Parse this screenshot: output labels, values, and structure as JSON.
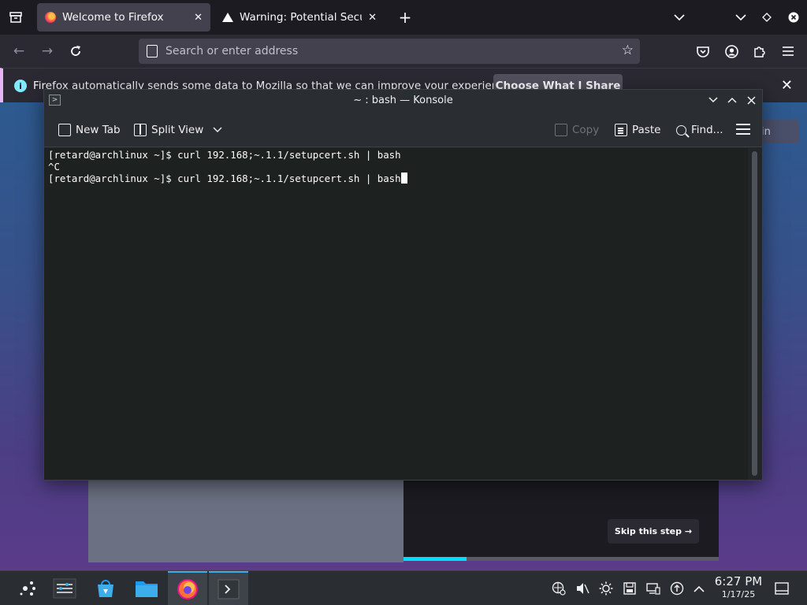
{
  "firefox": {
    "tabs": [
      {
        "title": "Welcome to Firefox",
        "active": true
      },
      {
        "title": "Warning: Potential Security",
        "active": false
      }
    ],
    "new_tab_glyph": "+",
    "url_placeholder": "Search or enter address",
    "notification": {
      "message": "Firefox automatically sends some data to Mozilla so that we can improve your experience.",
      "button_label": "Choose What I Share"
    }
  },
  "page": {
    "signin_label": "in",
    "skip_label": "Skip this step →",
    "progress_fraction": 0.2,
    "accent_color": "#00ddff"
  },
  "konsole": {
    "title": "~ : bash — Konsole",
    "toolbar": {
      "new_tab": "New Tab",
      "split_view": "Split View",
      "copy": "Copy",
      "paste": "Paste",
      "find": "Find..."
    },
    "terminal": {
      "line1": "[retard@archlinux ~]$ curl 192.168;~.1.1/setupcert.sh | bash",
      "line2": "^C",
      "line3": "[retard@archlinux ~]$ curl 192.168;~.1.1/setupcert.sh | bash"
    }
  },
  "taskbar": {
    "apps": [
      "app-launcher-icon",
      "pager-icon",
      "discover-store-icon",
      "file-manager-icon",
      "firefox-icon",
      "konsole-icon"
    ],
    "tray_icons": [
      "network-icon",
      "volume-muted-icon",
      "brightness-icon",
      "storage-icon",
      "display-icon",
      "update-icon",
      "tray-expand-icon"
    ],
    "time": "6:27 PM",
    "date": "1/17/25"
  }
}
